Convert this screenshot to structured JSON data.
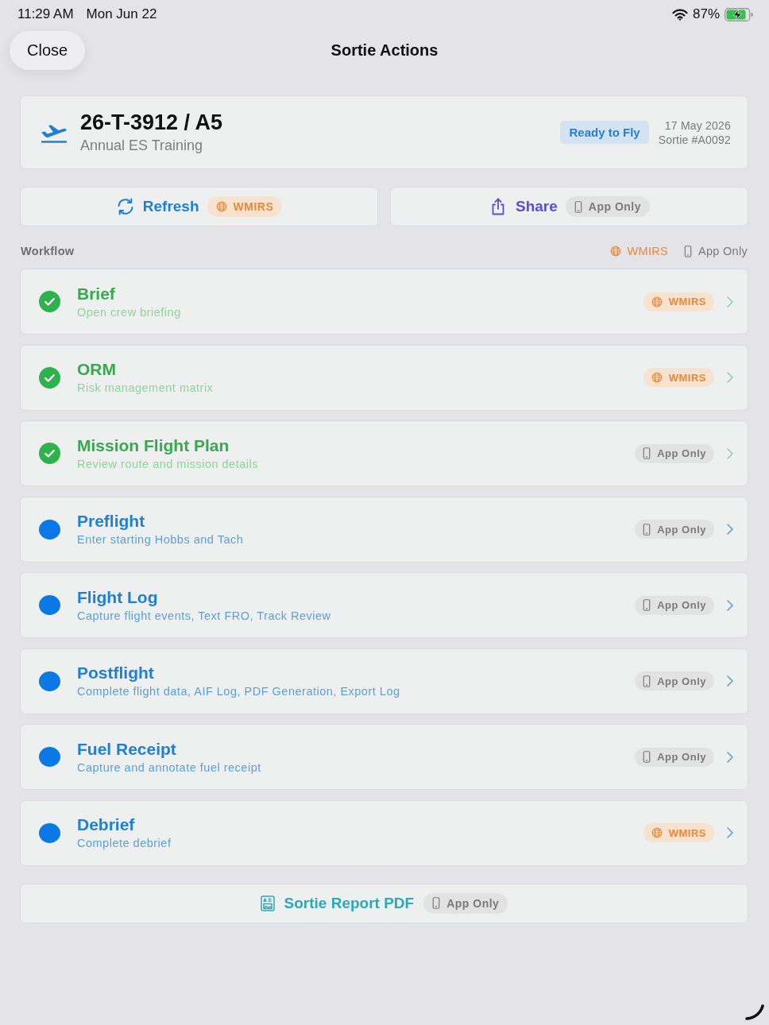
{
  "status_bar": {
    "time": "11:29 AM",
    "date": "Mon Jun 22",
    "battery": "87%"
  },
  "nav": {
    "close": "Close",
    "title": "Sortie Actions"
  },
  "sortie": {
    "tail": "26-T-3912 / A5",
    "mission": "Annual ES Training",
    "status": "Ready to Fly",
    "date": "17 May 2026",
    "number": "Sortie #A0092"
  },
  "actions": [
    {
      "kind": "refresh",
      "label": "Refresh",
      "tag": {
        "kind": "wmirs",
        "label": "WMIRS"
      }
    },
    {
      "kind": "share",
      "label": "Share",
      "tag": {
        "kind": "app",
        "label": "App Only"
      }
    }
  ],
  "workflow": {
    "title": "Workflow",
    "legend": [
      {
        "kind": "wmirs",
        "label": "WMIRS"
      },
      {
        "kind": "app",
        "label": "App Only"
      }
    ],
    "steps": [
      {
        "title": "Brief",
        "subtitle": "Open crew briefing",
        "completed": true,
        "tag": {
          "kind": "wmirs",
          "label": "WMIRS"
        }
      },
      {
        "title": "ORM",
        "subtitle": "Risk management matrix",
        "completed": true,
        "tag": {
          "kind": "wmirs",
          "label": "WMIRS"
        }
      },
      {
        "title": "Mission Flight Plan",
        "subtitle": "Review route and mission details",
        "completed": true,
        "tag": {
          "kind": "app",
          "label": "App Only"
        }
      },
      {
        "title": "Preflight",
        "subtitle": "Enter starting Hobbs and Tach",
        "completed": false,
        "tag": {
          "kind": "app",
          "label": "App Only"
        }
      },
      {
        "title": "Flight Log",
        "subtitle": "Capture flight events, Text FRO, Track Review",
        "completed": false,
        "tag": {
          "kind": "app",
          "label": "App Only"
        }
      },
      {
        "title": "Postflight",
        "subtitle": "Complete flight data, AIF Log, PDF Generation, Export Log",
        "completed": false,
        "tag": {
          "kind": "app",
          "label": "App Only"
        }
      },
      {
        "title": "Fuel Receipt",
        "subtitle": "Capture and annotate fuel receipt",
        "completed": false,
        "tag": {
          "kind": "app",
          "label": "App Only"
        }
      },
      {
        "title": "Debrief",
        "subtitle": "Complete debrief",
        "completed": false,
        "tag": {
          "kind": "wmirs",
          "label": "WMIRS"
        }
      }
    ]
  },
  "report": {
    "label": "Sortie Report PDF",
    "tag": {
      "kind": "app",
      "label": "App Only"
    }
  }
}
